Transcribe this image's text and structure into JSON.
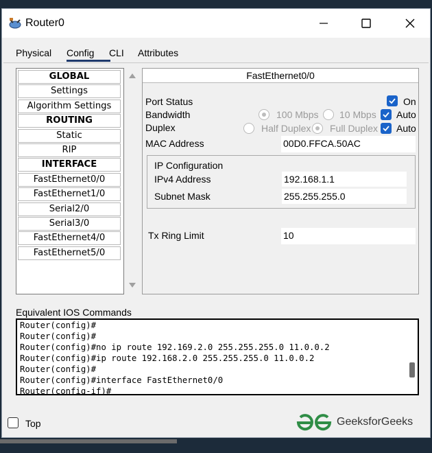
{
  "window": {
    "title": "Router0"
  },
  "tabs": [
    "Physical",
    "Config",
    "CLI",
    "Attributes"
  ],
  "active_tab": "Config",
  "left_list": [
    {
      "label": "GLOBAL",
      "header": true
    },
    {
      "label": "Settings",
      "header": false
    },
    {
      "label": "Algorithm Settings",
      "header": false
    },
    {
      "label": "ROUTING",
      "header": true
    },
    {
      "label": "Static",
      "header": false
    },
    {
      "label": "RIP",
      "header": false
    },
    {
      "label": "INTERFACE",
      "header": true
    },
    {
      "label": "FastEthernet0/0",
      "header": false
    },
    {
      "label": "FastEthernet1/0",
      "header": false
    },
    {
      "label": "Serial2/0",
      "header": false
    },
    {
      "label": "Serial3/0",
      "header": false
    },
    {
      "label": "FastEthernet4/0",
      "header": false
    },
    {
      "label": "FastEthernet5/0",
      "header": false
    }
  ],
  "interface": {
    "name": "FastEthernet0/0",
    "port_status_label": "Port Status",
    "port_on_label": "On",
    "port_on": true,
    "bandwidth_label": "Bandwidth",
    "bw_100": "100 Mbps",
    "bw_10": "10 Mbps",
    "bw_auto_label": "Auto",
    "bw_auto": true,
    "duplex_label": "Duplex",
    "half_duplex": "Half Duplex",
    "full_duplex": "Full Duplex",
    "duplex_auto_label": "Auto",
    "duplex_auto": true,
    "mac_label": "MAC Address",
    "mac_value": "00D0.FFCA.50AC",
    "ip_config_label": "IP Configuration",
    "ipv4_label": "IPv4 Address",
    "ipv4_value": "192.168.1.1",
    "subnet_label": "Subnet Mask",
    "subnet_value": "255.255.255.0",
    "tx_label": "Tx Ring Limit",
    "tx_value": "10"
  },
  "ios": {
    "label": "Equivalent IOS Commands",
    "lines": [
      "Router(config)#",
      "Router(config)#",
      "Router(config)#no ip route 192.169.2.0 255.255.255.0 11.0.0.2",
      "Router(config)#ip route 192.168.2.0 255.255.255.0 11.0.0.2",
      "Router(config)#",
      "Router(config)#interface FastEthernet0/0",
      "Router(config-if)#"
    ]
  },
  "footer": {
    "top_label": "Top",
    "top_checked": false,
    "brand": "GeeksforGeeks"
  },
  "colors": {
    "accent": "#1a63c9",
    "brand": "#2f8d46"
  }
}
